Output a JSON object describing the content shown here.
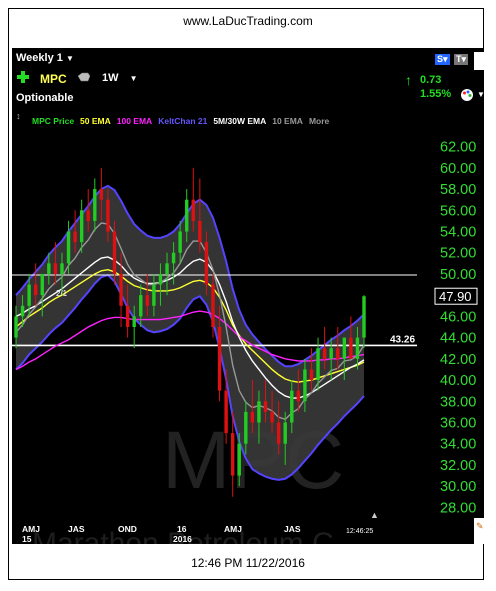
{
  "site_url": "www.LaDucTrading.com",
  "footer_timestamp": "12:46 PM 11/22/2016",
  "header": {
    "period": "Weekly 1",
    "symbol": "MPC",
    "interval": "1W",
    "optionable": "Optionable",
    "change": "0.73",
    "change_pct": "1.55%",
    "last_price_label": "47.90"
  },
  "legend": [
    {
      "label": "MPC Price",
      "color": "#22dd22"
    },
    {
      "label": "50 EMA",
      "color": "#ffff33"
    },
    {
      "label": "100 EMA",
      "color": "#ff22ff"
    },
    {
      "label": "KeltChan 21",
      "color": "#6655ff"
    },
    {
      "label": "5M/30W EMA",
      "color": "#ffffff"
    },
    {
      "label": "10 EMA",
      "color": "#999999"
    },
    {
      "label": "More",
      "color": "#999999"
    }
  ],
  "watermark": "MPC",
  "bottom_watermark": "Marathon Petroleum C",
  "annotations": {
    "price_line_label": "43.26",
    "split_label": "2/1",
    "chart_time": "12:46:25"
  },
  "colors": {
    "background": "#000000",
    "up_candle": "#22cc22",
    "down_candle": "#dd1111",
    "channel_fill": "#3a3a3a",
    "channel_edge": "#5544ff",
    "axis_text": "#33dd33"
  },
  "chart_data": {
    "type": "candlestick",
    "y_ticks": [
      "62.00",
      "60.00",
      "58.00",
      "56.00",
      "54.00",
      "52.00",
      "50.00",
      "48.00",
      "46.00",
      "44.00",
      "42.00",
      "40.00",
      "38.00",
      "36.00",
      "34.00",
      "32.00",
      "30.00",
      "28.00"
    ],
    "ylim": [
      27,
      63
    ],
    "x_ticks": [
      {
        "label": "AMJ",
        "sub": "15"
      },
      {
        "label": "JAS",
        "sub": ""
      },
      {
        "label": "OND",
        "sub": ""
      },
      {
        "label": "16",
        "sub": "2016"
      },
      {
        "label": "JAS",
        "sub": ""
      }
    ],
    "x_ticks_extra": [
      {
        "label": "AMJ",
        "sub": ""
      }
    ],
    "horizontal_lines": [
      49.9,
      43.26
    ],
    "series": [
      {
        "name": "MPC Price",
        "type": "candles",
        "values": [
          [
            44,
            47,
            43,
            46
          ],
          [
            46,
            48,
            45,
            47
          ],
          [
            47,
            50,
            46,
            49
          ],
          [
            49,
            51,
            47,
            48
          ],
          [
            48,
            50,
            46,
            50
          ],
          [
            50,
            52,
            49,
            51
          ],
          [
            51,
            53,
            49,
            50
          ],
          [
            50,
            52,
            48,
            51
          ],
          [
            51,
            55,
            50,
            54
          ],
          [
            54,
            56,
            52,
            53
          ],
          [
            53,
            57,
            52,
            56
          ],
          [
            56,
            58,
            54,
            55
          ],
          [
            55,
            59,
            54,
            58
          ],
          [
            58,
            60,
            55,
            57
          ],
          [
            57,
            58,
            53,
            54
          ],
          [
            54,
            55,
            49,
            50
          ],
          [
            50,
            52,
            45,
            47
          ],
          [
            47,
            49,
            44,
            45
          ],
          [
            45,
            47,
            43,
            46
          ],
          [
            46,
            49,
            45,
            48
          ],
          [
            48,
            50,
            46,
            47
          ],
          [
            47,
            50,
            46,
            49
          ],
          [
            49,
            51,
            47,
            50
          ],
          [
            50,
            52,
            48,
            51
          ],
          [
            51,
            53,
            49,
            52
          ],
          [
            52,
            55,
            51,
            54
          ],
          [
            54,
            58,
            53,
            57
          ],
          [
            57,
            60,
            54,
            55
          ],
          [
            55,
            59,
            52,
            53
          ],
          [
            53,
            54,
            48,
            49
          ],
          [
            49,
            50,
            44,
            45
          ],
          [
            45,
            47,
            38,
            39
          ],
          [
            39,
            41,
            34,
            35
          ],
          [
            35,
            37,
            29,
            31
          ],
          [
            31,
            35,
            30,
            34
          ],
          [
            34,
            38,
            33,
            37
          ],
          [
            37,
            40,
            35,
            36
          ],
          [
            36,
            39,
            34,
            38
          ],
          [
            38,
            40,
            36,
            37
          ],
          [
            37,
            39,
            35,
            36
          ],
          [
            36,
            38,
            33,
            34
          ],
          [
            34,
            37,
            32,
            36
          ],
          [
            36,
            40,
            35,
            39
          ],
          [
            39,
            41,
            37,
            38
          ],
          [
            38,
            42,
            37,
            41
          ],
          [
            41,
            43,
            39,
            40
          ],
          [
            40,
            44,
            39,
            43
          ],
          [
            43,
            45,
            41,
            42
          ],
          [
            42,
            44,
            40,
            43
          ],
          [
            43,
            45,
            41,
            42
          ],
          [
            42,
            44,
            40,
            44
          ],
          [
            44,
            46,
            42,
            42
          ],
          [
            42,
            45,
            41,
            44
          ],
          [
            44,
            48,
            43,
            47.9
          ]
        ]
      },
      {
        "name": "50 EMA",
        "values": [
          45,
          45.5,
          46,
          46.4,
          46.8,
          47.3,
          47.7,
          48,
          48.4,
          48.8,
          49.2,
          49.6,
          50,
          50.3,
          50.4,
          50.2,
          49.8,
          49.3,
          48.9,
          48.7,
          48.5,
          48.4,
          48.4,
          48.4,
          48.5,
          48.7,
          49,
          49.3,
          49.4,
          49.2,
          48.7,
          47.8,
          46.6,
          45.2,
          44.2,
          43.4,
          42.8,
          42.2,
          41.6,
          41,
          40.5,
          40.1,
          39.9,
          39.8,
          39.9,
          40,
          40.2,
          40.4,
          40.6,
          40.8,
          41,
          41.2,
          41.4,
          41.7
        ]
      },
      {
        "name": "100 EMA",
        "values": [
          41,
          41.3,
          41.7,
          42,
          42.4,
          42.8,
          43.2,
          43.5,
          43.8,
          44.2,
          44.6,
          45,
          45.3,
          45.6,
          45.8,
          45.9,
          45.9,
          45.8,
          45.7,
          45.7,
          45.7,
          45.7,
          45.7,
          45.8,
          45.9,
          46,
          46.2,
          46.4,
          46.5,
          46.4,
          46.2,
          45.8,
          45.3,
          44.7,
          44.1,
          43.7,
          43.3,
          43,
          42.7,
          42.4,
          42.2,
          42,
          41.9,
          41.8,
          41.8,
          41.8,
          41.9,
          41.9,
          42,
          42,
          42.1,
          42.2,
          42.3,
          42.4
        ]
      },
      {
        "name": "5M/30W EMA",
        "values": [
          46,
          46.3,
          46.7,
          47,
          47.4,
          47.8,
          48.2,
          48.6,
          49.1,
          49.6,
          50.1,
          50.6,
          51.1,
          51.5,
          51.6,
          51.3,
          50.8,
          50.1,
          49.6,
          49.3,
          49.1,
          49.1,
          49.2,
          49.4,
          49.7,
          50.1,
          50.7,
          51.2,
          51.4,
          51.1,
          50.3,
          49,
          47.4,
          45.5,
          44,
          42.8,
          41.8,
          41,
          40.2,
          39.5,
          38.9,
          38.5,
          38.3,
          38.3,
          38.5,
          38.8,
          39.2,
          39.6,
          40,
          40.4,
          40.8,
          41.2,
          41.5,
          41.9
        ]
      },
      {
        "name": "10 EMA",
        "values": [
          44.5,
          45.2,
          46.2,
          46.9,
          47.7,
          48.6,
          49.2,
          49.7,
          50.8,
          51.5,
          52.5,
          53.2,
          54.2,
          54.8,
          54.7,
          53.8,
          52.4,
          50.9,
          49.9,
          49.5,
          49,
          49,
          49.2,
          49.6,
          50.1,
          51,
          52.3,
          53.1,
          53.1,
          52,
          50.4,
          48,
          45,
          41.4,
          39,
          37.9,
          37.4,
          37.6,
          37.4,
          37.1,
          36.5,
          36.3,
          36.9,
          37.3,
          38.2,
          38.8,
          39.7,
          40.3,
          40.9,
          41.1,
          41.8,
          41.9,
          42.3,
          43.3
        ]
      },
      {
        "name": "KeltChan 21",
        "upper": [
          48,
          48.7,
          49.5,
          50.2,
          50.9,
          51.8,
          52.5,
          53.1,
          54,
          54.8,
          55.6,
          56.4,
          57.3,
          58,
          58.3,
          57.9,
          56.9,
          55.7,
          54.7,
          54.1,
          53.6,
          53.4,
          53.4,
          53.6,
          54,
          54.7,
          55.7,
          56.6,
          57,
          56.5,
          55.3,
          53.4,
          51.2,
          48.6,
          46.6,
          45.2,
          44.3,
          43.6,
          42.9,
          42.3,
          41.7,
          41.3,
          41.3,
          41.5,
          41.9,
          42.3,
          42.8,
          43.3,
          43.8,
          44.2,
          44.7,
          45.1,
          45.6,
          46.2
        ],
        "lower": [
          41,
          41.6,
          42.4,
          43,
          43.6,
          44.3,
          44.9,
          45.4,
          46.1,
          46.8,
          47.6,
          48.3,
          49.1,
          49.7,
          49.9,
          49.3,
          48.1,
          46.8,
          45.8,
          45.2,
          44.7,
          44.5,
          44.6,
          44.8,
          45.2,
          45.8,
          46.8,
          47.6,
          47.9,
          47.1,
          45.5,
          43,
          40.1,
          36.6,
          34.2,
          32.6,
          31.6,
          31.2,
          30.9,
          30.7,
          30.6,
          30.7,
          31.1,
          31.7,
          32.4,
          33.1,
          33.9,
          34.6,
          35.3,
          35.9,
          36.6,
          37.2,
          37.8,
          38.5
        ]
      }
    ]
  }
}
